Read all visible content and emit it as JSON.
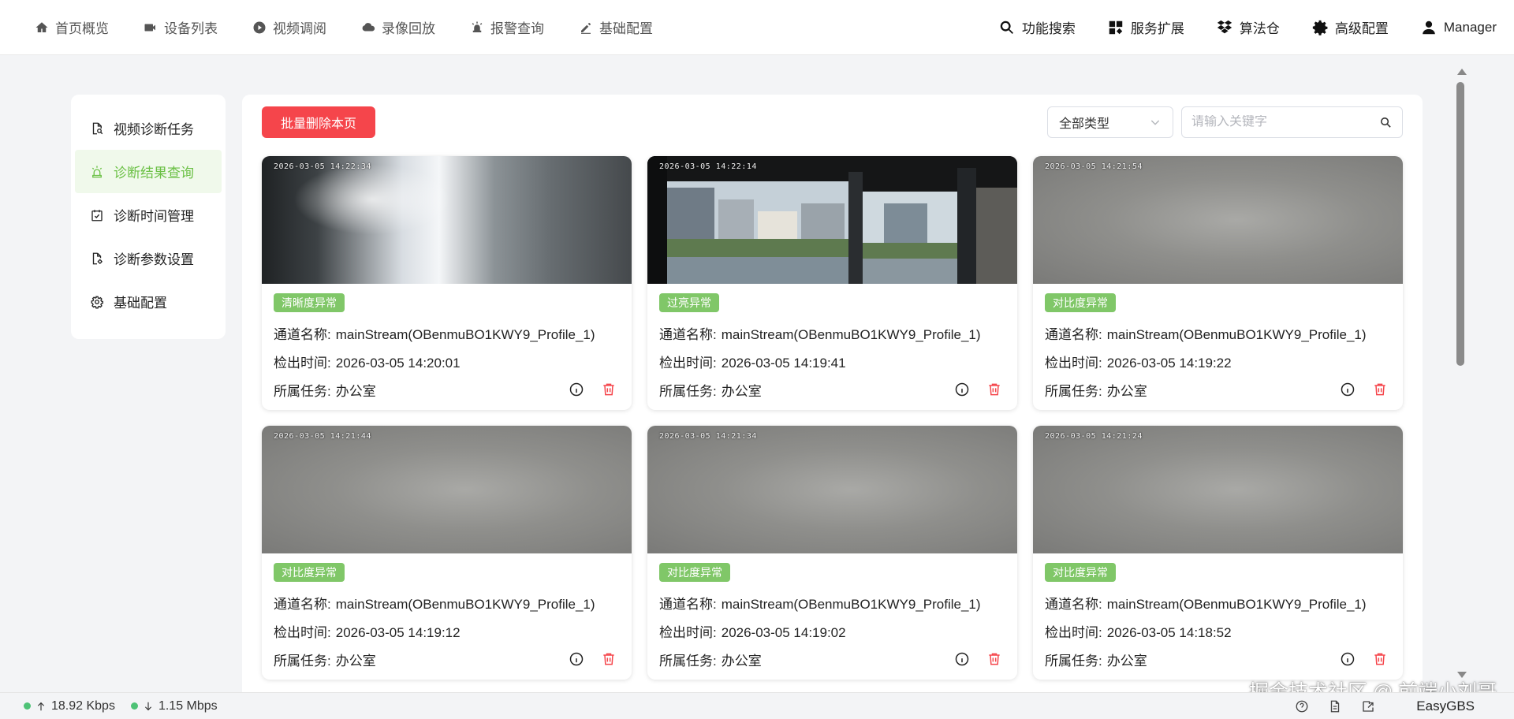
{
  "nav": {
    "left": [
      {
        "label": "首页概览",
        "icon": "home-icon"
      },
      {
        "label": "设备列表",
        "icon": "camera-icon"
      },
      {
        "label": "视频调阅",
        "icon": "play-circle-icon"
      },
      {
        "label": "录像回放",
        "icon": "cloud-icon"
      },
      {
        "label": "报警查询",
        "icon": "alarm-icon"
      },
      {
        "label": "基础配置",
        "icon": "pencil-icon"
      }
    ],
    "right": [
      {
        "label": "功能搜索",
        "icon": "search-icon"
      },
      {
        "label": "服务扩展",
        "icon": "apps-icon"
      },
      {
        "label": "算法仓",
        "icon": "dropbox-icon"
      },
      {
        "label": "高级配置",
        "icon": "gear-icon"
      },
      {
        "label": "Manager",
        "icon": "user-icon"
      }
    ]
  },
  "sidebar": {
    "items": [
      {
        "label": "视频诊断任务",
        "icon": "document-search-icon",
        "active": false
      },
      {
        "label": "诊断结果查询",
        "icon": "alarm-light-icon",
        "active": true
      },
      {
        "label": "诊断时间管理",
        "icon": "calendar-check-icon",
        "active": false
      },
      {
        "label": "诊断参数设置",
        "icon": "document-settings-icon",
        "active": false
      },
      {
        "label": "基础配置",
        "icon": "gear-icon",
        "active": false
      }
    ]
  },
  "toolbar": {
    "batch_delete_label": "批量删除本页",
    "type_select_value": "全部类型",
    "search_placeholder": "请输入关键字"
  },
  "field_labels": {
    "channel": "通道名称:",
    "time": "检出时间:",
    "task": "所属任务:"
  },
  "cards": [
    {
      "timestamp": "2026-03-05  14:22:34",
      "badge": "清晰度异常",
      "channel": "mainStream(OBenmuBO1KWY9_Profile_1)",
      "time": "2026-03-05 14:20:01",
      "task": "办公室",
      "thumb": "bright"
    },
    {
      "timestamp": "2026-03-05  14:22:14",
      "badge": "过亮异常",
      "channel": "mainStream(OBenmuBO1KWY9_Profile_1)",
      "time": "2026-03-05 14:19:41",
      "task": "办公室",
      "thumb": "window"
    },
    {
      "timestamp": "2026-03-05  14:21:54",
      "badge": "对比度异常",
      "channel": "mainStream(OBenmuBO1KWY9_Profile_1)",
      "time": "2026-03-05 14:19:22",
      "task": "办公室",
      "thumb": "blur"
    },
    {
      "timestamp": "2026-03-05  14:21:44",
      "badge": "对比度异常",
      "channel": "mainStream(OBenmuBO1KWY9_Profile_1)",
      "time": "2026-03-05 14:19:12",
      "task": "办公室",
      "thumb": "blur"
    },
    {
      "timestamp": "2026-03-05  14:21:34",
      "badge": "对比度异常",
      "channel": "mainStream(OBenmuBO1KWY9_Profile_1)",
      "time": "2026-03-05 14:19:02",
      "task": "办公室",
      "thumb": "blur"
    },
    {
      "timestamp": "2026-03-05  14:21:24",
      "badge": "对比度异常",
      "channel": "mainStream(OBenmuBO1KWY9_Profile_1)",
      "time": "2026-03-05 14:18:52",
      "task": "办公室",
      "thumb": "blur"
    }
  ],
  "footer": {
    "upload_rate": "18.92 Kbps",
    "download_rate": "1.15 Mbps",
    "brand": "EasyGBS"
  },
  "watermark": "掘金技术社区 @ 前端小刘哥",
  "colors": {
    "accent_green": "#6ac044",
    "badge_green": "#80c768",
    "danger_red": "#f5454b",
    "status_dot": "#4ec276"
  }
}
